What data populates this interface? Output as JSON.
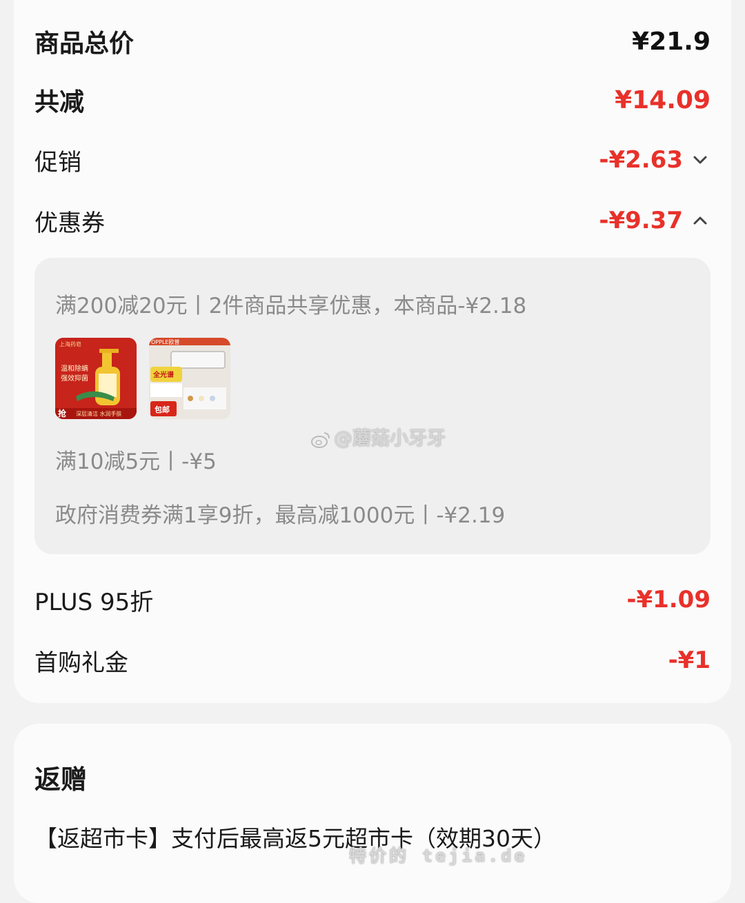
{
  "summary": {
    "total_label": "商品总价",
    "total_value": "¥21.9",
    "discount_label": "共减",
    "discount_value": "¥14.09"
  },
  "promo": {
    "label": "促销",
    "value": "-¥2.63",
    "icon": "chevron-down-icon"
  },
  "coupon": {
    "label": "优惠券",
    "value": "-¥9.37",
    "icon": "chevron-up-icon"
  },
  "coupon_details": {
    "line1": "满200减20元丨2件商品共享优惠，本商品-¥2.18",
    "line2": "满10减5元丨-¥5",
    "line3": "政府消费券满1享9折，最高减1000元丨-¥2.19",
    "products": [
      {
        "name": "hand-soap-product",
        "badge": "上海药皂",
        "text1": "温和除螨",
        "text2": "强效抑菌",
        "text3": "抢",
        "text4": "深层清洁 水润手肤"
      },
      {
        "name": "ceiling-lamp-product",
        "badge": "OPPLE欧普",
        "text1": "全光谱",
        "text2": "包邮"
      }
    ]
  },
  "plus": {
    "label": "PLUS 95折",
    "value": "-¥1.09"
  },
  "first_gift": {
    "label": "首购礼金",
    "value": "-¥1"
  },
  "gift": {
    "title": "返赠",
    "text": "【返超市卡】支付后最高返5元超市卡（效期30天）"
  },
  "watermarks": {
    "weibo": "@蘑菇小牙牙",
    "site": "特价的 tejia.de"
  },
  "colors": {
    "accent_red": "#e8312a",
    "panel": "#efefef",
    "card": "#fbfbfb"
  }
}
